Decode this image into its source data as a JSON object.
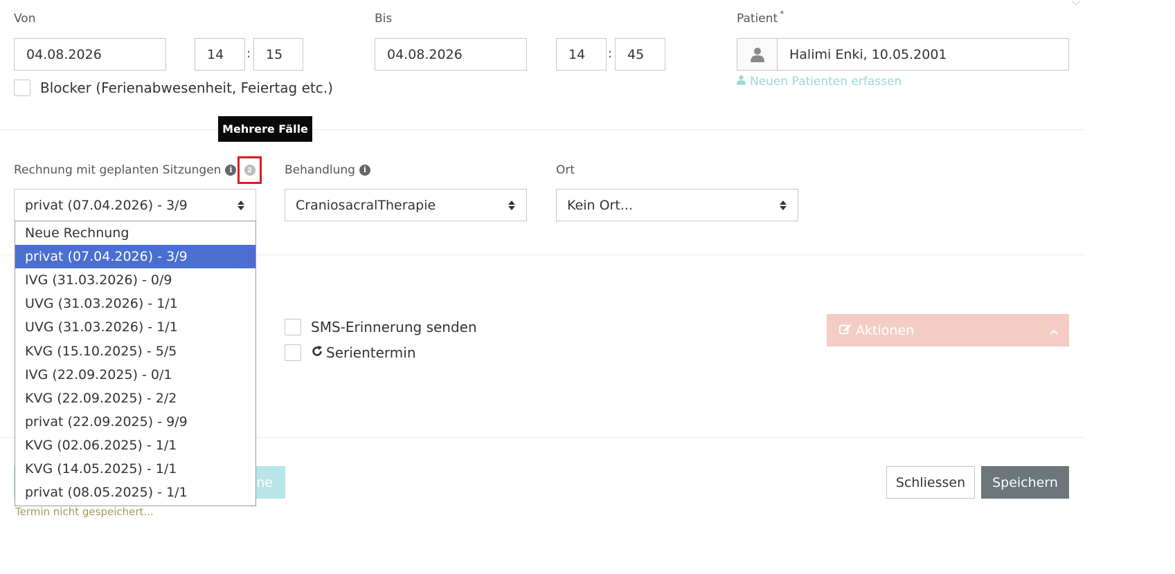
{
  "from": {
    "label": "Von",
    "date": "04.08.2026",
    "hour": "14",
    "minute": "15"
  },
  "to": {
    "label": "Bis",
    "date": "04.08.2026",
    "hour": "14",
    "minute": "45"
  },
  "time_separator": ":",
  "patient": {
    "label": "Patient",
    "required_mark": "*",
    "value": "Halimi Enki, 10.05.2001",
    "new_patient_link": "Neuen Patienten erfassen"
  },
  "blocker": {
    "label": "Blocker (Ferienabwesenheit, Feiertag etc.)"
  },
  "tooltip": "Mehrere Fälle",
  "invoice": {
    "label": "Rechnung mit geplanten Sitzungen",
    "badge": "2",
    "selected": "privat (07.04.2026) - 3/9",
    "options": [
      "Neue Rechnung",
      "privat (07.04.2026) - 3/9",
      "IVG (31.03.2026) - 0/9",
      "UVG (31.03.2026) - 1/1",
      "UVG (31.03.2026) - 1/1",
      "KVG (15.10.2025) - 5/5",
      "IVG (22.09.2025) - 0/1",
      "KVG (22.09.2025) - 2/2",
      "privat (22.09.2025) - 9/9",
      "KVG (02.06.2025) - 1/1",
      "KVG (14.05.2025) - 1/1",
      "privat (08.05.2025) - 1/1"
    ],
    "highlighted_index": 1
  },
  "treatment": {
    "label": "Behandlung",
    "value": "CraniosacralTherapie"
  },
  "location": {
    "label": "Ort",
    "value": "Kein Ort..."
  },
  "sms_reminder": {
    "label": "SMS-Erinnerung senden"
  },
  "recurring": {
    "label": "Serientermin"
  },
  "actions": {
    "label": "Aktionen"
  },
  "footer": {
    "partial_button_text": "ine",
    "close_label": "Schliessen",
    "save_label": "Speichern",
    "status": "Termin nicht gespeichert..."
  },
  "icons": {
    "info": "info-icon",
    "user": "user-icon",
    "edit": "edit-icon",
    "refresh": "refresh-icon",
    "chevron_up": "chevron-up-icon"
  },
  "colors": {
    "selected_option": "#4a6fd1",
    "teal_link": "#9ad9d6",
    "actions_bg": "#f3cdc4",
    "save_bg": "#6c757a",
    "highlight_border": "#e2191f",
    "status_text": "#a39a58"
  }
}
